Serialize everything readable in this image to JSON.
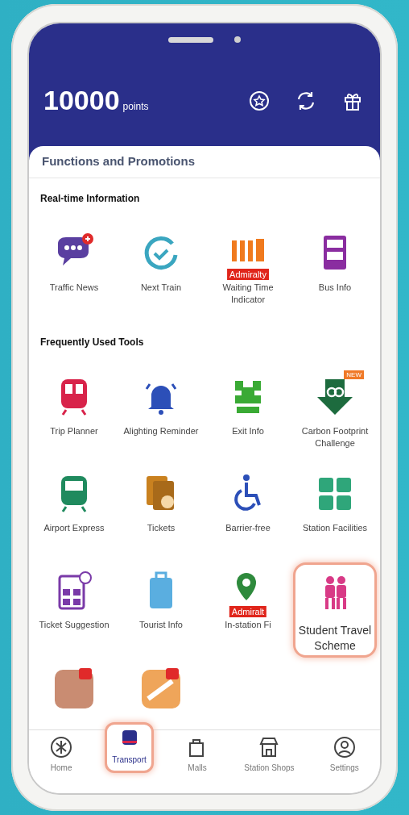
{
  "header": {
    "points": "10000",
    "points_unit": "points"
  },
  "panel_title": "Functions and Promotions",
  "sections": [
    {
      "title": "Real-time Information",
      "items": [
        {
          "label": "Traffic News",
          "highlighted": false
        },
        {
          "label": "Next Train",
          "highlighted": false
        },
        {
          "label": "Waiting Time Indicator",
          "badge": "Admiralty",
          "highlighted": false
        },
        {
          "label": "Bus Info",
          "highlighted": false
        }
      ]
    },
    {
      "title": "Frequently Used Tools",
      "items": [
        {
          "label": "Trip Planner",
          "highlighted": false
        },
        {
          "label": "Alighting Reminder",
          "highlighted": false
        },
        {
          "label": "Exit Info",
          "highlighted": false
        },
        {
          "label": "Carbon Footprint Challenge",
          "badge": "NEW",
          "highlighted": false
        },
        {
          "label": "Airport Express",
          "highlighted": false
        },
        {
          "label": "Tickets",
          "highlighted": false
        },
        {
          "label": "Barrier-free",
          "highlighted": false
        },
        {
          "label": "Station Facilities",
          "highlighted": false
        },
        {
          "label": "Ticket Suggestion",
          "highlighted": false
        },
        {
          "label": "Tourist Info",
          "highlighted": false
        },
        {
          "label": "In-station Fi",
          "badge": "Admiralt",
          "highlighted": false
        },
        {
          "label": "Student Travel Scheme",
          "highlighted": true
        },
        {
          "highlighted": false
        },
        {
          "highlighted": false
        }
      ]
    }
  ],
  "tabs": [
    {
      "label": "Home",
      "selected": false
    },
    {
      "label": "Transport",
      "selected": true
    },
    {
      "label": "Malls",
      "selected": false
    },
    {
      "label": "Station Shops",
      "selected": false
    },
    {
      "label": "Settings",
      "selected": false
    }
  ]
}
